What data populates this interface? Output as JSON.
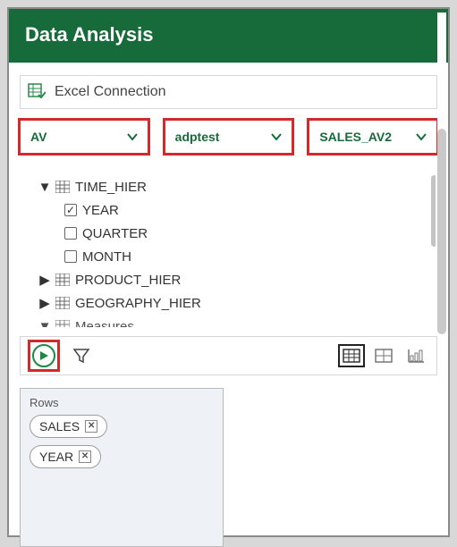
{
  "header": {
    "title": "Data Analysis"
  },
  "connection": {
    "label": "Excel Connection"
  },
  "selectors": {
    "av": {
      "value": "AV"
    },
    "schema": {
      "value": "adptest"
    },
    "object": {
      "value": "SALES_AV2"
    }
  },
  "tree": {
    "items": [
      {
        "kind": "node",
        "expanded": true,
        "label": "TIME_HIER"
      },
      {
        "kind": "leaf",
        "checked": true,
        "label": "YEAR"
      },
      {
        "kind": "leaf",
        "checked": false,
        "label": "QUARTER"
      },
      {
        "kind": "leaf",
        "checked": false,
        "label": "MONTH"
      },
      {
        "kind": "node",
        "expanded": false,
        "label": "PRODUCT_HIER"
      },
      {
        "kind": "node",
        "expanded": false,
        "label": "GEOGRAPHY_HIER"
      },
      {
        "kind": "node",
        "expanded": true,
        "label": "Measures"
      }
    ]
  },
  "toolbar": {
    "run_title": "Run",
    "filter_title": "Filter",
    "views": {
      "table_title": "Table",
      "pivot_title": "Pivot",
      "chart_title": "Chart"
    }
  },
  "rows_panel": {
    "title": "Rows",
    "chips": [
      {
        "label": "SALES"
      },
      {
        "label": "YEAR"
      }
    ]
  }
}
